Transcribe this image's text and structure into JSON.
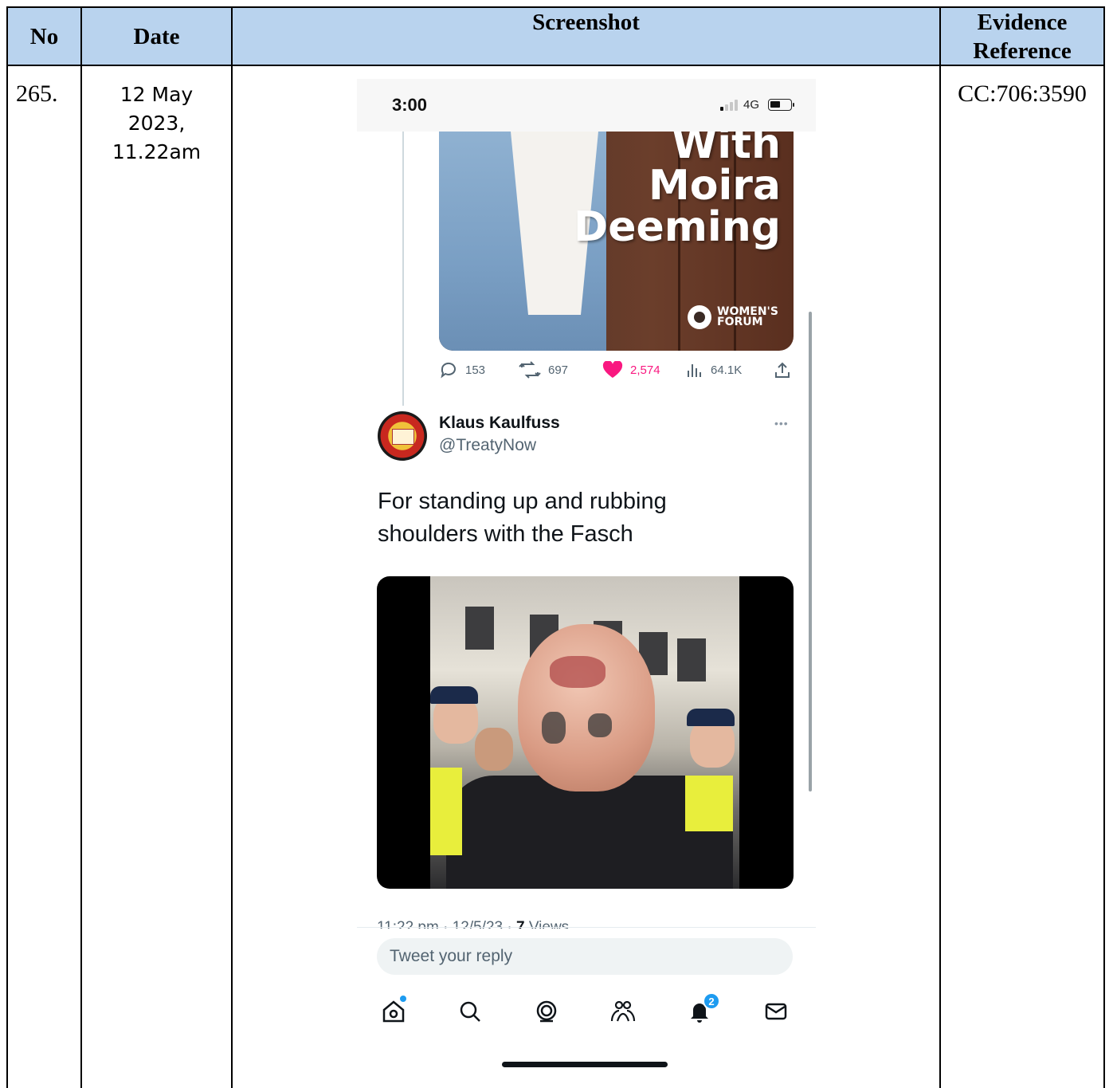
{
  "table": {
    "headers": {
      "no": "No",
      "date": "Date",
      "screenshot": "Screenshot",
      "evidence_reference": "Evidence Reference"
    },
    "row": {
      "no": "265.",
      "date_line1": "12 May",
      "date_line2": "2023,",
      "date_line3": "11.22am",
      "evidence_reference": "CC:706:3590"
    }
  },
  "phone": {
    "status_time": "3:00",
    "network": "4G",
    "promo_title_line1": "With",
    "promo_title_line2": "Moira",
    "promo_title_line3": "Deeming",
    "promo_logo_line1": "WOMEN'S",
    "promo_logo_line2": "FORUM",
    "actions": {
      "replies": "153",
      "retweets": "697",
      "likes": "2,574",
      "views": "64.1K"
    },
    "tweet": {
      "display_name": "Klaus Kaulfuss",
      "handle": "@TreatyNow",
      "text_line1": "For standing up and rubbing",
      "text_line2": "shoulders with the Fasch",
      "timestamp": "11:22 pm · 12/5/23 ·",
      "views_count": "7",
      "views_label": "Views"
    },
    "reply_placeholder": "Tweet your reply",
    "notification_badge": "2",
    "colors": {
      "like": "#f91880",
      "accent": "#1d9bf0",
      "header_bg": "#b9d3ee"
    }
  }
}
